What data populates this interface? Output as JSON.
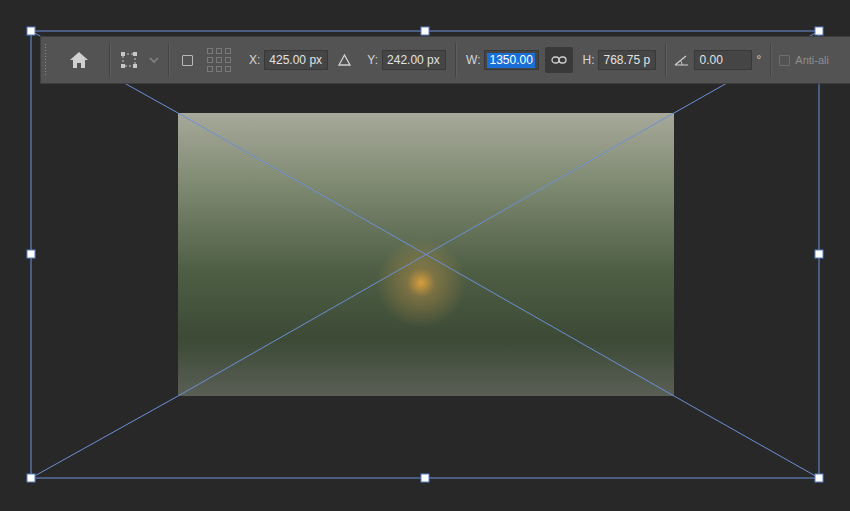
{
  "toolbar": {
    "fields": [
      {
        "label": "X:",
        "value": "425.00 px",
        "selected": false
      },
      {
        "label": "Y:",
        "value": "242.00 px",
        "selected": false
      },
      {
        "label": "W:",
        "value": "1350.00",
        "selected": true
      },
      {
        "label": "H:",
        "value": "768.75 p",
        "selected": false
      }
    ],
    "link": {
      "on": true
    },
    "angle": {
      "value": "0.00",
      "unit": "°"
    },
    "reference_point": {
      "checked": false
    },
    "anti_alias": {
      "label": "Anti-ali",
      "checked": false,
      "disabled": true
    }
  }
}
